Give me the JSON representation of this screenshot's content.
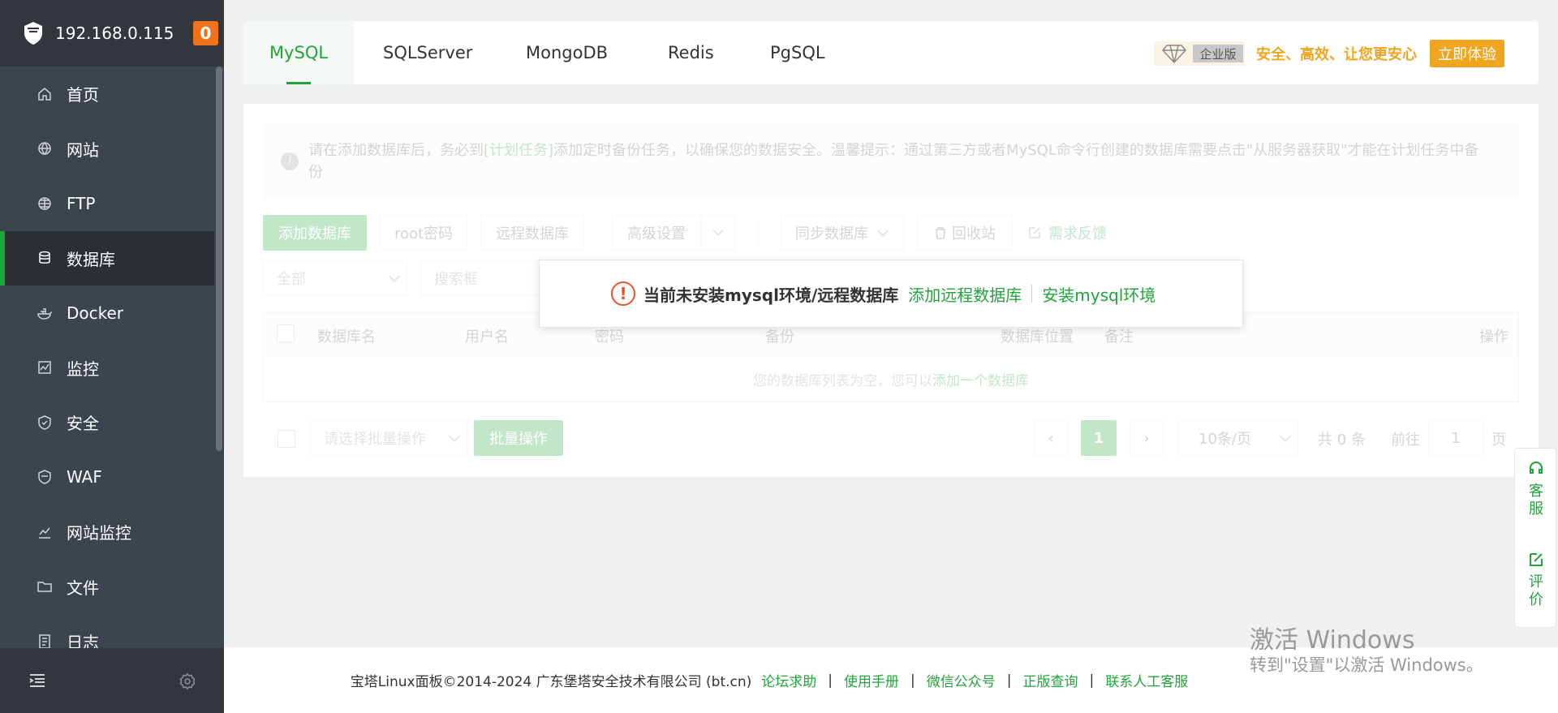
{
  "sidebar": {
    "ip": "192.168.0.115",
    "badge": "0",
    "items": [
      {
        "label": "首页",
        "icon": "home-icon"
      },
      {
        "label": "网站",
        "icon": "globe-icon"
      },
      {
        "label": "FTP",
        "icon": "ftp-globe-icon"
      },
      {
        "label": "数据库",
        "icon": "database-icon",
        "active": true
      },
      {
        "label": "Docker",
        "icon": "docker-icon"
      },
      {
        "label": "监控",
        "icon": "monitor-icon"
      },
      {
        "label": "安全",
        "icon": "shield-icon"
      },
      {
        "label": "WAF",
        "icon": "waf-shield-icon"
      },
      {
        "label": "网站监控",
        "icon": "chart-line-icon"
      },
      {
        "label": "文件",
        "icon": "folder-icon"
      },
      {
        "label": "日志",
        "icon": "log-icon"
      }
    ]
  },
  "tabs": [
    {
      "label": "MySQL",
      "active": true
    },
    {
      "label": "SQLServer"
    },
    {
      "label": "MongoDB"
    },
    {
      "label": "Redis"
    },
    {
      "label": "PgSQL"
    }
  ],
  "enterprise": {
    "tag": "企业版",
    "slogan": "安全、高效、让您更安心",
    "button": "立即体验"
  },
  "notice": {
    "pre": "请在添加数据库后，务必到",
    "link": "[计划任务]",
    "post": "添加定时备份任务，以确保您的数据安全。温馨提示：通过第三方或者MySQL命令行创建的数据库需要点击\"从服务器获取\"才能在计划任务中备份"
  },
  "toolbar": {
    "add_db": "添加数据库",
    "root_pwd": "root密码",
    "remote_db": "远程数据库",
    "advanced": "高级设置",
    "sync_db": "同步数据库",
    "recycle": "回收站",
    "feedback": "需求反馈",
    "filter_all": "全部",
    "search_placeholder": "搜索框"
  },
  "table": {
    "headers": [
      "数据库名",
      "用户名",
      "密码",
      "备份",
      "数据库位置",
      "备注",
      "操作"
    ],
    "empty_pre": "您的数据库列表为空，您可以",
    "empty_link": "添加一个数据库"
  },
  "pager": {
    "batch_placeholder": "请选择批量操作",
    "batch_btn": "批量操作",
    "current": "1",
    "per_page": "10条/页",
    "total": "共 0 条",
    "goto_label": "前往",
    "goto_value": "1",
    "page_suffix": "页"
  },
  "modal": {
    "message": "当前未安装mysql环境/远程数据库",
    "link1": "添加远程数据库",
    "link2": "安装mysql环境"
  },
  "footer": {
    "copyright": "宝塔Linux面板©2014-2024 广东堡塔安全技术有限公司 (bt.cn)",
    "links": [
      "论坛求助",
      "使用手册",
      "微信公众号",
      "正版查询",
      "联系人工客服"
    ]
  },
  "watermark": {
    "line1": "激活 Windows",
    "line2": "转到\"设置\"以激活 Windows。"
  },
  "float": {
    "service": "客服",
    "review": "评价"
  }
}
